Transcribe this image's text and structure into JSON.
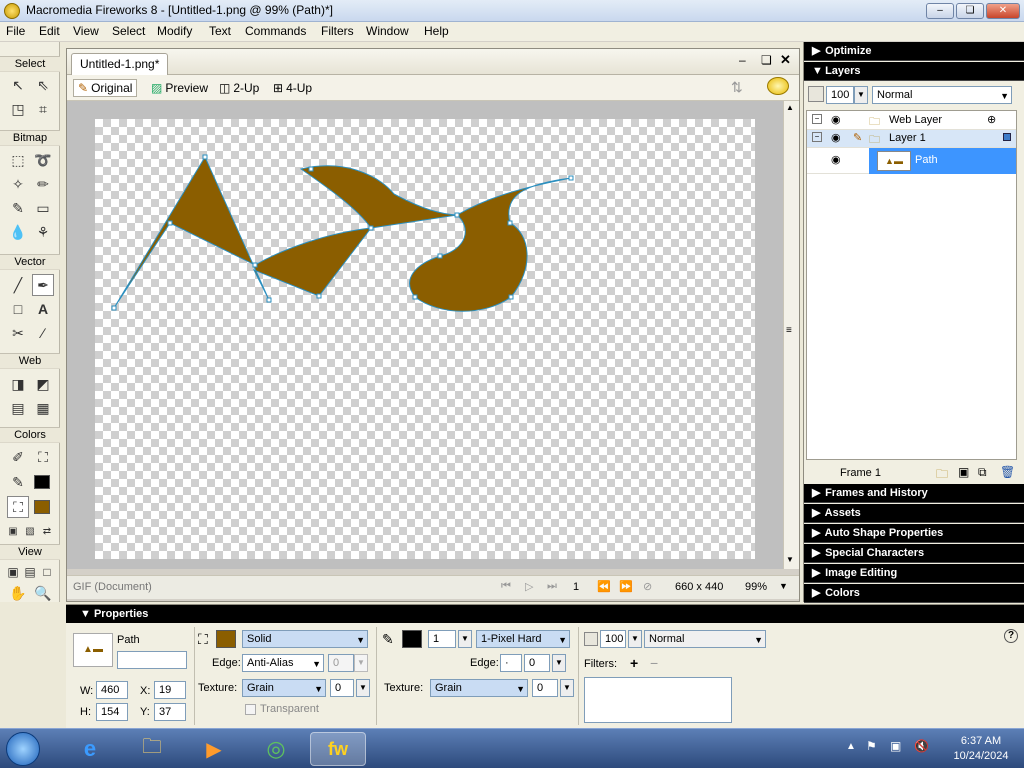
{
  "window": {
    "title": "Macromedia Fireworks 8 - [Untitled-1.png @ 99% (Path)*]",
    "minimize": "–",
    "restore": "❏",
    "close": "✕"
  },
  "menu": [
    "File",
    "Edit",
    "View",
    "Select",
    "Modify",
    "Text",
    "Commands",
    "Filters",
    "Window",
    "Help"
  ],
  "tools": {
    "sections": [
      "Select",
      "Bitmap",
      "Vector",
      "Web",
      "Colors",
      "View"
    ]
  },
  "document": {
    "tab_label": "Untitled-1.png*",
    "view_buttons": [
      "Original",
      "Preview",
      "2-Up",
      "4-Up"
    ],
    "status_format": "GIF (Document)",
    "frame_number": "1",
    "canvas_size": "660 x 440",
    "zoom": "99%"
  },
  "panels": {
    "optimize": "Optimize",
    "layers": "Layers",
    "opacity": "100",
    "blend_mode": "Normal",
    "layer_rows": [
      "Web Layer",
      "Layer 1",
      "Path"
    ],
    "frame_label": "Frame 1",
    "collapsed": [
      "Frames and History",
      "Assets",
      "Auto Shape Properties",
      "Special Characters",
      "Image Editing",
      "Colors"
    ]
  },
  "properties": {
    "title": "Properties",
    "object_type": "Path",
    "object_name": "",
    "w_label": "W:",
    "w": "460",
    "x_label": "X:",
    "x": "19",
    "h_label": "H:",
    "h": "154",
    "y_label": "Y:",
    "y": "37",
    "fill_type": "Solid",
    "fill_color": "#8B5E00",
    "edge_label": "Edge:",
    "edge": "Anti-Alias",
    "edge_amount": "0",
    "texture_label": "Texture:",
    "texture": "Grain",
    "texture_amount": "0",
    "transparent_label": "Transparent",
    "stroke_size": "1",
    "stroke_type": "1-Pixel Hard",
    "stroke_edge_amount": "0",
    "stroke_texture": "Grain",
    "stroke_texture_amount": "0",
    "opacity": "100",
    "blend": "Normal",
    "filters_label": "Filters:"
  },
  "taskbar": {
    "time": "6:37 AM",
    "date": "10/24/2024"
  },
  "colors": {
    "shape_fill": "#8B5E00",
    "selection": "#3d95ff",
    "panel_header": "#000000"
  }
}
